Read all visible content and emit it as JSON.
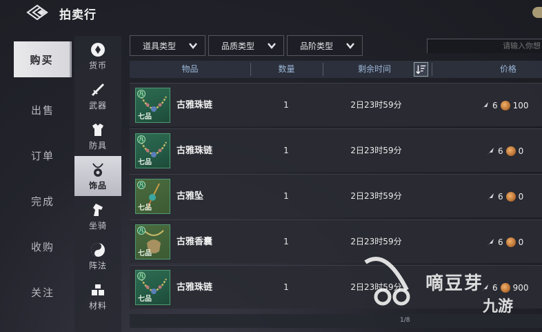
{
  "header": {
    "title": "拍卖行",
    "back_icon": "back-diamond-icon"
  },
  "main_menu": [
    {
      "label": "购买",
      "active": true
    },
    {
      "label": "出售",
      "active": false
    },
    {
      "label": "订单",
      "active": false
    },
    {
      "label": "完成",
      "active": false
    },
    {
      "label": "收购",
      "active": false
    },
    {
      "label": "关注",
      "active": false
    }
  ],
  "categories": [
    {
      "label": "货币",
      "icon": "currency-icon",
      "active": false
    },
    {
      "label": "武器",
      "icon": "sword-icon",
      "active": false
    },
    {
      "label": "防具",
      "icon": "armor-icon",
      "active": false
    },
    {
      "label": "饰品",
      "icon": "necklace-icon",
      "active": true
    },
    {
      "label": "坐骑",
      "icon": "horse-icon",
      "active": false
    },
    {
      "label": "阵法",
      "icon": "formation-icon",
      "active": false
    },
    {
      "label": "材料",
      "icon": "materials-icon",
      "active": false
    }
  ],
  "filters": {
    "item_type": "道具类型",
    "quality_type": "品质类型",
    "tier_type": "品阶类型"
  },
  "search": {
    "placeholder": "请输入你想"
  },
  "table": {
    "columns": {
      "item": "物品",
      "quantity": "数量",
      "remaining_time": "剩余时间",
      "price": "价格"
    },
    "rows": [
      {
        "name": "古雅珠链",
        "quantity": "1",
        "time": "2日23时59分",
        "price_a": "6",
        "price_b": "100",
        "grade": "七品",
        "badge": "凡"
      },
      {
        "name": "古雅珠链",
        "quantity": "1",
        "time": "2日23时59分",
        "price_a": "6",
        "price_b": "0",
        "grade": "七品",
        "badge": "凡"
      },
      {
        "name": "古雅坠",
        "quantity": "1",
        "time": "2日23时59分",
        "price_a": "6",
        "price_b": "0",
        "grade": "七品",
        "badge": "凡"
      },
      {
        "name": "古雅香囊",
        "quantity": "1",
        "time": "2日23时59分",
        "price_a": "6",
        "price_b": "0",
        "grade": "七品",
        "badge": "凡"
      },
      {
        "name": "古雅珠链",
        "quantity": "1",
        "time": "2日23时59分",
        "price_a": "6",
        "price_b": "900",
        "grade": "七品",
        "badge": "凡"
      }
    ]
  },
  "pagination": {
    "text": "1/8"
  },
  "watermark": {
    "text1": "嘀豆芽",
    "text2": "九游"
  },
  "colors": {
    "accent": "#9bb6d6",
    "item_green": "#2e6b52",
    "coin": "#b36a2c"
  }
}
